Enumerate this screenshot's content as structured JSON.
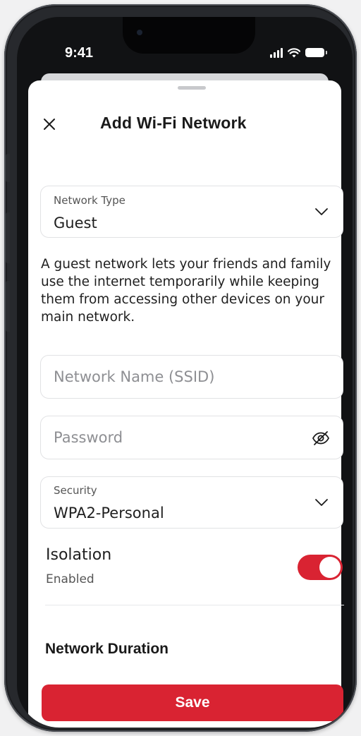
{
  "status_bar": {
    "time": "9:41",
    "icons": [
      "signal-icon",
      "wifi-icon",
      "battery-icon"
    ]
  },
  "header": {
    "title": "Add Wi-Fi Network",
    "close_icon": "close-icon"
  },
  "network_type": {
    "label": "Network Type",
    "value": "Guest",
    "icon": "chevron-down-icon"
  },
  "description": "A guest network lets your friends and family use the internet temporarily while keeping them from accessing other devices on your main network.",
  "ssid": {
    "placeholder": "Network Name (SSID)",
    "value": ""
  },
  "password": {
    "placeholder": "Password",
    "value": "",
    "icon": "eye-off-icon"
  },
  "security": {
    "label": "Security",
    "value": "WPA2-Personal",
    "icon": "chevron-down-icon"
  },
  "isolation": {
    "label": "Isolation",
    "status": "Enabled",
    "toggle_on": true
  },
  "duration": {
    "title": "Network Duration"
  },
  "actions": {
    "save_label": "Save"
  },
  "colors": {
    "accent": "#d92332",
    "text": "#1f1f1f",
    "muted": "#555555",
    "border": "#e1e2e4"
  }
}
